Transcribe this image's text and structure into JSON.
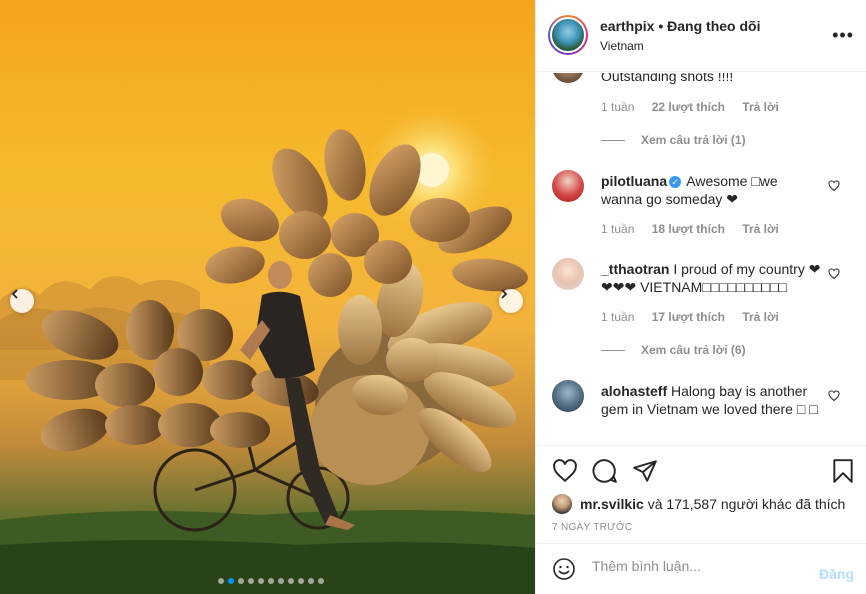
{
  "post": {
    "username": "earthpix",
    "separator": "•",
    "follow_status": "Đang theo dõi",
    "location": "Vietnam",
    "more_glyph": "•••"
  },
  "carousel": {
    "dot_count": 11,
    "active_index": 1
  },
  "comments": [
    {
      "username": "",
      "text": "Outstanding shots !!!!",
      "time": "1 tuần",
      "likes": "22 lượt thích",
      "reply": "Trả lời",
      "view_replies": "Xem câu trả lời (1)"
    },
    {
      "username": "pilotluana",
      "verified": true,
      "text": "Awesome □we wanna go someday ❤",
      "time": "1 tuần",
      "likes": "18 lượt thích",
      "reply": "Trả lời"
    },
    {
      "username": "_tthaotran",
      "text": "I proud of my country ❤❤❤❤ VIETNAM□□□□□□□□□□",
      "time": "1 tuần",
      "likes": "17 lượt thích",
      "reply": "Trả lời",
      "view_replies": "Xem câu trả lời (6)"
    },
    {
      "username": "alohasteff",
      "text": "Halong bay is another gem in Vietnam we loved there □ □"
    }
  ],
  "likes": {
    "first_user": "mr.svilkic",
    "rest": " và 171,587 người khác đã thích"
  },
  "timestamp": "7 NGÀY TRƯỚC",
  "add_comment": {
    "placeholder": "Thêm bình luận...",
    "post_label": "Đăng"
  },
  "colors": {
    "accent_blue": "#0095f6",
    "verified": "#3897f0",
    "muted": "#8e8e8e",
    "post_disabled": "#b2dffc"
  }
}
